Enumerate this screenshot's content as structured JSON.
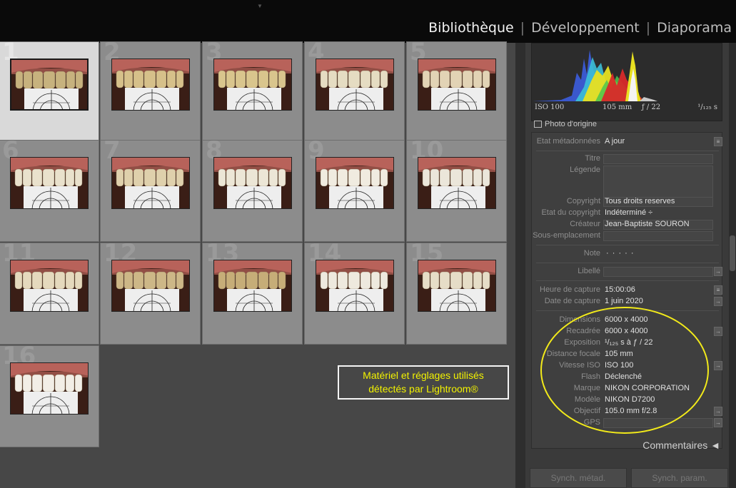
{
  "modules": {
    "library": "Bibliothèque",
    "develop": "Développement",
    "slideshow": "Diaporama",
    "sep": "|"
  },
  "grid": {
    "cells": [
      {
        "num": "1",
        "selected": true,
        "tooth": "#c7b27e"
      },
      {
        "num": "2",
        "selected": false,
        "tooth": "#d6c08a"
      },
      {
        "num": "3",
        "selected": false,
        "tooth": "#d9c58d"
      },
      {
        "num": "4",
        "selected": false,
        "tooth": "#e5dcc2"
      },
      {
        "num": "5",
        "selected": false,
        "tooth": "#e2d3b5"
      },
      {
        "num": "6",
        "selected": false,
        "tooth": "#e9e1cc"
      },
      {
        "num": "7",
        "selected": false,
        "tooth": "#dfd0ac"
      },
      {
        "num": "8",
        "selected": false,
        "tooth": "#ece6d6"
      },
      {
        "num": "9",
        "selected": false,
        "tooth": "#f0ebe0"
      },
      {
        "num": "10",
        "selected": false,
        "tooth": "#ebe6da"
      },
      {
        "num": "11",
        "selected": false,
        "tooth": "#e5d9bd"
      },
      {
        "num": "12",
        "selected": false,
        "tooth": "#cdb787"
      },
      {
        "num": "13",
        "selected": false,
        "tooth": "#c6ad78"
      },
      {
        "num": "14",
        "selected": false,
        "tooth": "#eee9de"
      },
      {
        "num": "15",
        "selected": false,
        "tooth": "#e6ddc7"
      },
      {
        "num": "16",
        "selected": false,
        "tooth": "#f2eee6"
      }
    ]
  },
  "histogram": {
    "iso": "ISO 100",
    "focal": "105 mm",
    "aperture": "ƒ / 22",
    "shutter": "¹/₁₂₅ s"
  },
  "original_photo": "Photo d'origine",
  "metadata": {
    "status_label": "Etat métadonnées",
    "status_value": "A jour",
    "title_label": "Titre",
    "caption_label": "Légende",
    "copyright_label": "Copyright",
    "copyright_value": "Tous droits reserves",
    "copyright_status_label": "Etat du copyright",
    "copyright_status_value": "Indéterminé ÷",
    "creator_label": "Créateur",
    "creator_value": "Jean-Baptiste SOURON",
    "sublocation_label": "Sous-emplacement",
    "rating_label": "Note",
    "rating_value": "·  ·  ·  ·  ·",
    "label_label": "Libellé",
    "capture_time_label": "Heure de capture",
    "capture_time_value": "15:00:06",
    "capture_date_label": "Date de capture",
    "capture_date_value": "1 juin 2020",
    "dimensions_label": "Dimensions",
    "dimensions_value": "6000 x 4000",
    "cropped_label": "Recadrée",
    "cropped_value": "6000 x 4000",
    "exposure_label": "Exposition",
    "exposure_value": "¹/₁₂₅ s à ƒ / 22",
    "focal_label": "Distance focale",
    "focal_value": "105 mm",
    "iso_label": "Vitesse ISO",
    "iso_value": "ISO 100",
    "flash_label": "Flash",
    "flash_value": "Déclenché",
    "make_label": "Marque",
    "make_value": "NIKON CORPORATION",
    "model_label": "Modèle",
    "model_value": "NIKON D7200",
    "lens_label": "Objectif",
    "lens_value": "105.0 mm f/2.8",
    "gps_label": "GPS"
  },
  "comments": "Commentaires ◄",
  "sync": {
    "metadata": "Synch. métad.",
    "settings": "Synch. param."
  },
  "callout": {
    "line1": "Matériel et réglages utilisés",
    "line2": "détectés par Lightroom®"
  },
  "colors": {
    "annotation": "#f2ea1a",
    "gum": "#b8625a",
    "background": "#474747"
  }
}
